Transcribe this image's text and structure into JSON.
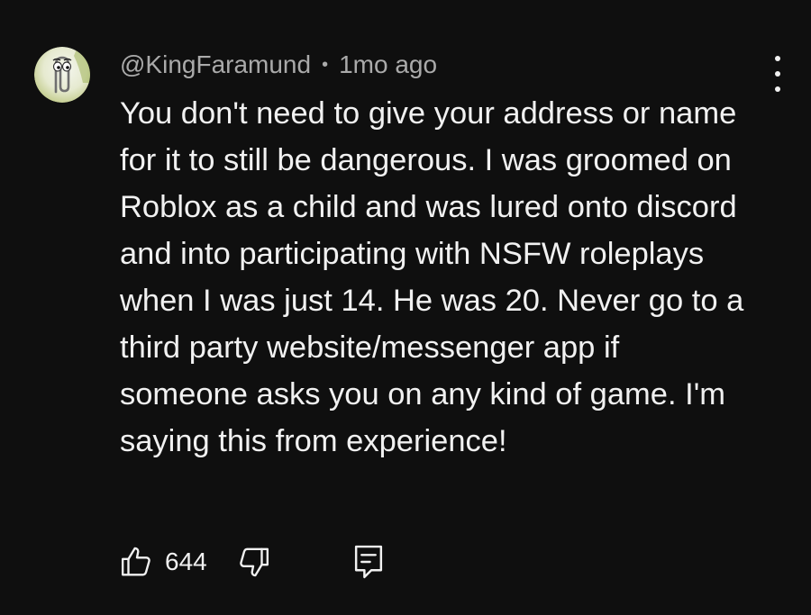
{
  "comment": {
    "author": "@KingFaramund",
    "separator": "•",
    "time": "1mo ago",
    "text": "You don't need to give your address or name for it to still be dangerous. I was groomed on Roblox as a child and was lured onto discord and into participating with NSFW roleplays when I was just 14. He was 20. Never go to a third party website/messenger app if someone asks you on any kind of game. I'm saying this from experience!",
    "likes": "644"
  },
  "icons": {
    "avatar": "paperclip-avatar-icon",
    "menu": "more-vertical-icon",
    "like": "thumbs-up-icon",
    "dislike": "thumbs-down-icon",
    "reply": "reply-comment-icon"
  },
  "colors": {
    "background": "#0f0f0f",
    "text": "#f1f1f1",
    "secondary_text": "#aaaaaa"
  }
}
